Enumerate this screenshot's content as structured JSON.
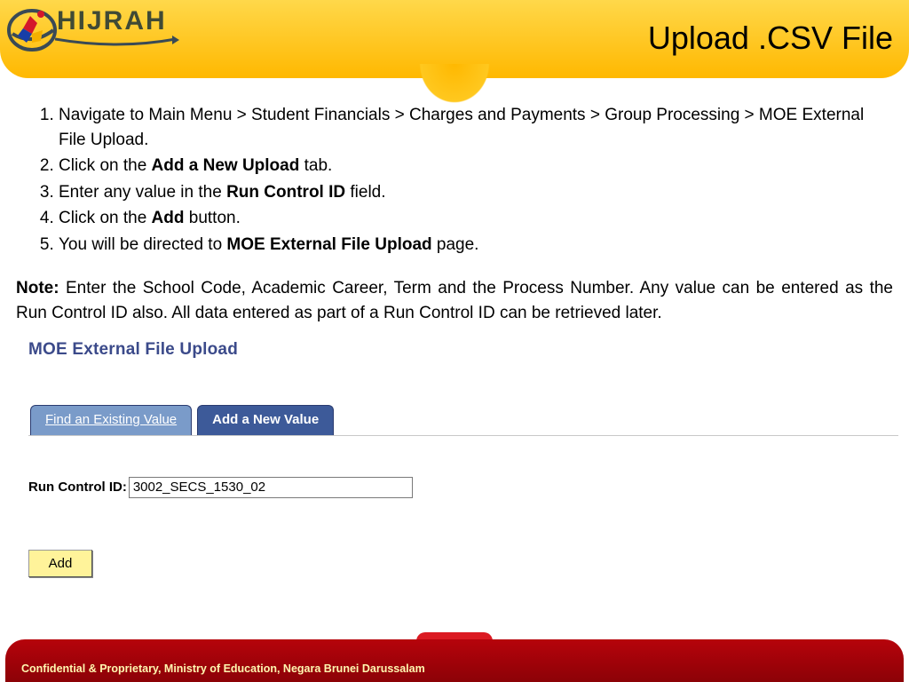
{
  "header": {
    "logo_text": "HIJRAH",
    "page_title": "Upload .CSV File"
  },
  "instructions": {
    "steps": [
      {
        "pre": "Navigate to Main Menu > Student Financials > Charges and Payments > Group Processing > MOE External File Upload."
      },
      {
        "pre": "Click on the ",
        "bold": "Add a New Upload",
        "post": " tab."
      },
      {
        "pre": "Enter any value in the ",
        "bold": "Run Control ID",
        "post": " field."
      },
      {
        "pre": "Click on the ",
        "bold": "Add",
        "post": " button."
      },
      {
        "pre": "You will be directed to ",
        "bold": "MOE External File Upload",
        "post": " page."
      }
    ],
    "note_label": "Note:",
    "note_body": " Enter the School Code, Academic Career, Term and the Process Number. Any value can be entered as the Run Control ID also. All data entered as part of a Run Control ID can be retrieved later."
  },
  "app": {
    "heading": "MOE External File Upload",
    "tabs": {
      "inactive": "Find an Existing Value",
      "active": "Add a New Value"
    },
    "form": {
      "run_control_label": "Run Control ID:",
      "run_control_value": "3002_SECS_1530_02"
    },
    "add_button": "Add"
  },
  "footer": {
    "text": "Confidential & Proprietary, Ministry of Education, Negara Brunei Darussalam"
  }
}
